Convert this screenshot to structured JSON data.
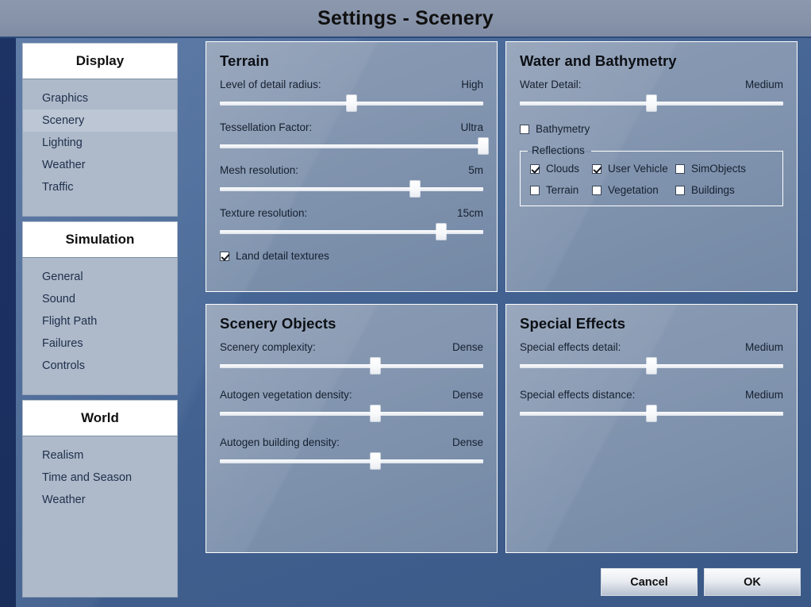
{
  "window": {
    "title": "Settings - Scenery"
  },
  "sidebar": {
    "groups": [
      {
        "title": "Display",
        "items": [
          {
            "label": "Graphics",
            "selected": false
          },
          {
            "label": "Scenery",
            "selected": true
          },
          {
            "label": "Lighting",
            "selected": false
          },
          {
            "label": "Weather",
            "selected": false
          },
          {
            "label": "Traffic",
            "selected": false
          }
        ]
      },
      {
        "title": "Simulation",
        "items": [
          {
            "label": "General",
            "selected": false
          },
          {
            "label": "Sound",
            "selected": false
          },
          {
            "label": "Flight Path",
            "selected": false
          },
          {
            "label": "Failures",
            "selected": false
          },
          {
            "label": "Controls",
            "selected": false
          }
        ]
      },
      {
        "title": "World",
        "items": [
          {
            "label": "Realism",
            "selected": false
          },
          {
            "label": "Time and Season",
            "selected": false
          },
          {
            "label": "Weather",
            "selected": false
          }
        ]
      }
    ]
  },
  "terrain": {
    "title": "Terrain",
    "sliders": [
      {
        "label": "Level of detail radius:",
        "value": "High",
        "percent": 50
      },
      {
        "label": "Tessellation Factor:",
        "value": "Ultra",
        "percent": 100
      },
      {
        "label": "Mesh resolution:",
        "value": "5m",
        "percent": 74
      },
      {
        "label": "Texture resolution:",
        "value": "15cm",
        "percent": 84
      }
    ],
    "checkbox": {
      "label": "Land detail textures",
      "checked": true
    }
  },
  "water": {
    "title": "Water and Bathymetry",
    "sliders": [
      {
        "label": "Water Detail:",
        "value": "Medium",
        "percent": 50
      }
    ],
    "bathymetry": {
      "label": "Bathymetry",
      "checked": false
    },
    "reflections": {
      "legend": "Reflections",
      "items": [
        {
          "label": "Clouds",
          "checked": true
        },
        {
          "label": "User Vehicle",
          "checked": true
        },
        {
          "label": "SimObjects",
          "checked": false
        },
        {
          "label": "Terrain",
          "checked": false
        },
        {
          "label": "Vegetation",
          "checked": false
        },
        {
          "label": "Buildings",
          "checked": false
        }
      ]
    }
  },
  "scenery_objects": {
    "title": "Scenery Objects",
    "sliders": [
      {
        "label": "Scenery complexity:",
        "value": "Dense",
        "percent": 59
      },
      {
        "label": "Autogen vegetation density:",
        "value": "Dense",
        "percent": 59
      },
      {
        "label": "Autogen building density:",
        "value": "Dense",
        "percent": 59
      }
    ]
  },
  "special_effects": {
    "title": "Special Effects",
    "sliders": [
      {
        "label": "Special effects detail:",
        "value": "Medium",
        "percent": 50
      },
      {
        "label": "Special effects distance:",
        "value": "Medium",
        "percent": 50
      }
    ]
  },
  "footer": {
    "cancel_label": "Cancel",
    "ok_label": "OK"
  }
}
